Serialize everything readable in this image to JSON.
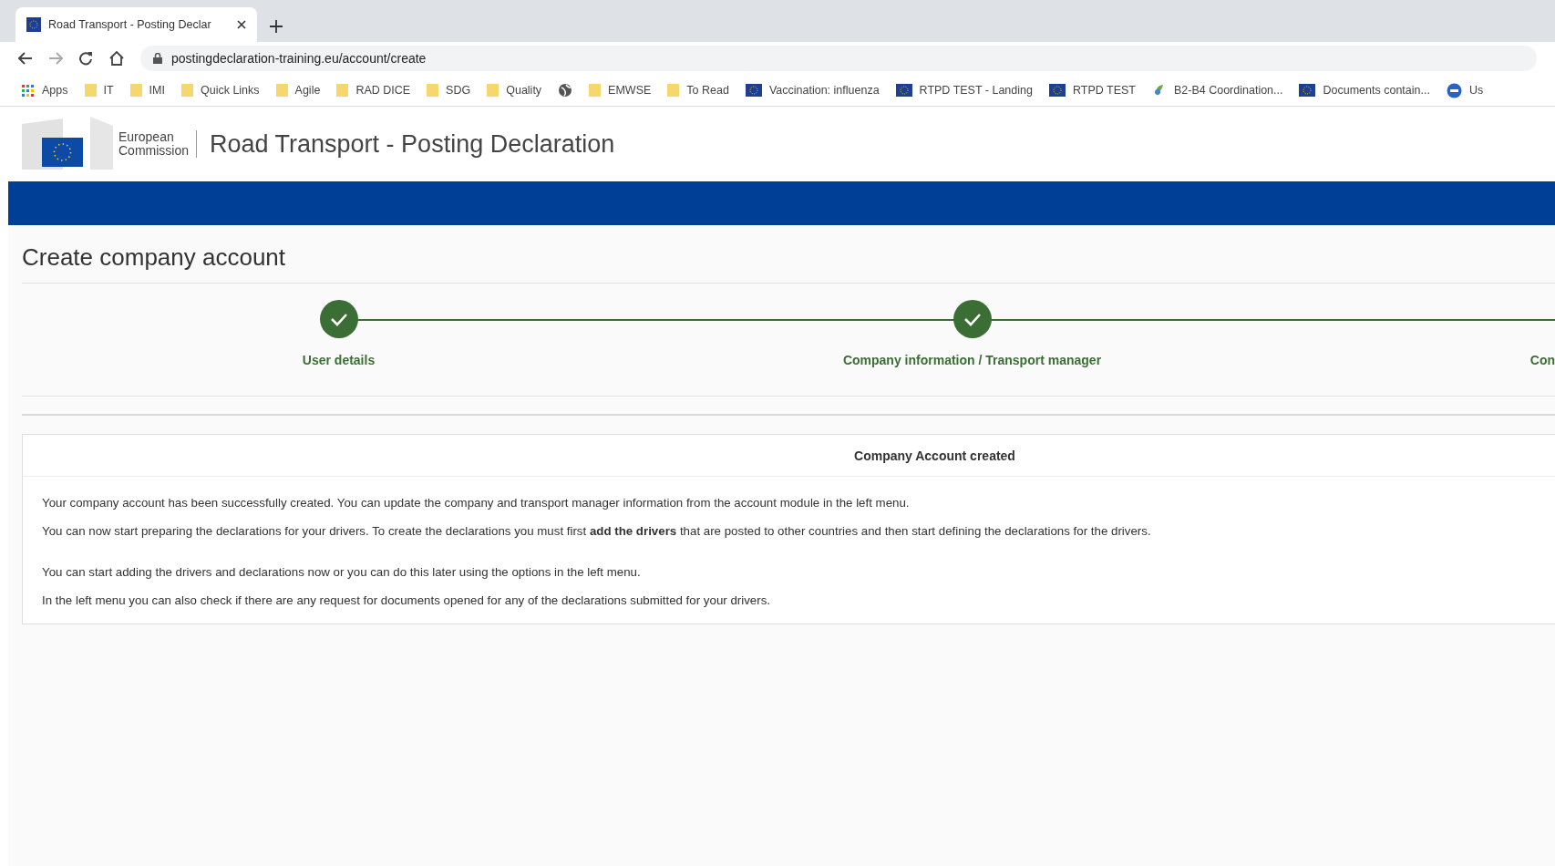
{
  "browser": {
    "tab": {
      "title": "Road Transport - Posting Declar",
      "selected": true
    },
    "address": "postingdeclaration-training.eu/account/create",
    "bookmarks": [
      {
        "kind": "apps",
        "label": "Apps"
      },
      {
        "kind": "folder",
        "label": "IT"
      },
      {
        "kind": "folder",
        "label": "IMI"
      },
      {
        "kind": "folder",
        "label": "Quick Links"
      },
      {
        "kind": "folder",
        "label": "Agile"
      },
      {
        "kind": "folder",
        "label": "RAD DICE"
      },
      {
        "kind": "folder",
        "label": "SDG"
      },
      {
        "kind": "folder",
        "label": "Quality"
      },
      {
        "kind": "globe"
      },
      {
        "kind": "folder",
        "label": "EMWSE"
      },
      {
        "kind": "folder",
        "label": "To Read"
      },
      {
        "kind": "flag",
        "label": "Vaccination: influenza"
      },
      {
        "kind": "flag",
        "label": "RTPD TEST - Landing"
      },
      {
        "kind": "flag",
        "label": "RTPD TEST"
      },
      {
        "kind": "leaf",
        "label": "B2-B4 Coordination..."
      },
      {
        "kind": "flag",
        "label": "Documents contain..."
      },
      {
        "kind": "round",
        "label": "Us"
      }
    ]
  },
  "header": {
    "logo_text": [
      "European",
      "Commission"
    ],
    "title": "Road Transport - Posting Declaration"
  },
  "page_title": "Create company account",
  "stepper": [
    {
      "label": "User details",
      "completed": true
    },
    {
      "label": "Company information / Transport manager",
      "completed": true
    },
    {
      "label": "Con"
    }
  ],
  "card": {
    "title": "Company Account created",
    "paragraphs": [
      "Your company account has been successfully created. You can update the company and transport manager information from the account module in the left menu.",
      "You can now start preparing the declarations for your drivers. To create the declarations you must first **add the drivers** that are posted to other countries and then start defining the declarations for the drivers.",
      "You can start adding the drivers and declarations now or you can do this later using the options in the left menu.",
      "In the left menu you can also check if there are any request for documents opened for any of the declarations submitted for your drivers."
    ]
  }
}
